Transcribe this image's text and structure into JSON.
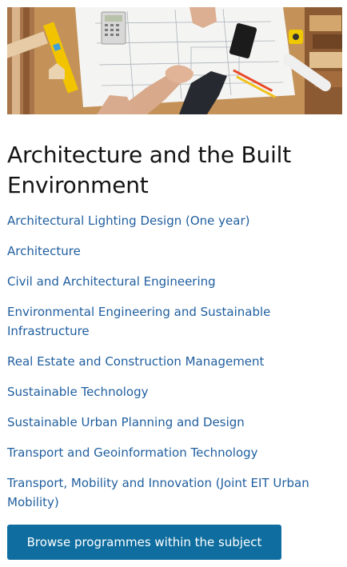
{
  "hero": {
    "image": "architecture-desk-photo"
  },
  "section": {
    "title": "Architecture and the Built Environment"
  },
  "programmes": [
    {
      "label": "Architectural Lighting Design (One year)"
    },
    {
      "label": "Architecture"
    },
    {
      "label": "Civil and Architectural Engineering"
    },
    {
      "label": "Environmental Engineering and Sustainable Infrastructure"
    },
    {
      "label": "Real Estate and Construction Management"
    },
    {
      "label": "Sustainable Technology"
    },
    {
      "label": "Sustainable Urban Planning and Design"
    },
    {
      "label": "Transport and Geoinformation Technology"
    },
    {
      "label": "Transport, Mobility and Innovation (Joint EIT Urban Mobility)"
    }
  ],
  "cta": {
    "label": "Browse programmes within the subject"
  },
  "colors": {
    "link": "#1f5e9e",
    "button": "#0f6e9f",
    "title": "#141414"
  }
}
